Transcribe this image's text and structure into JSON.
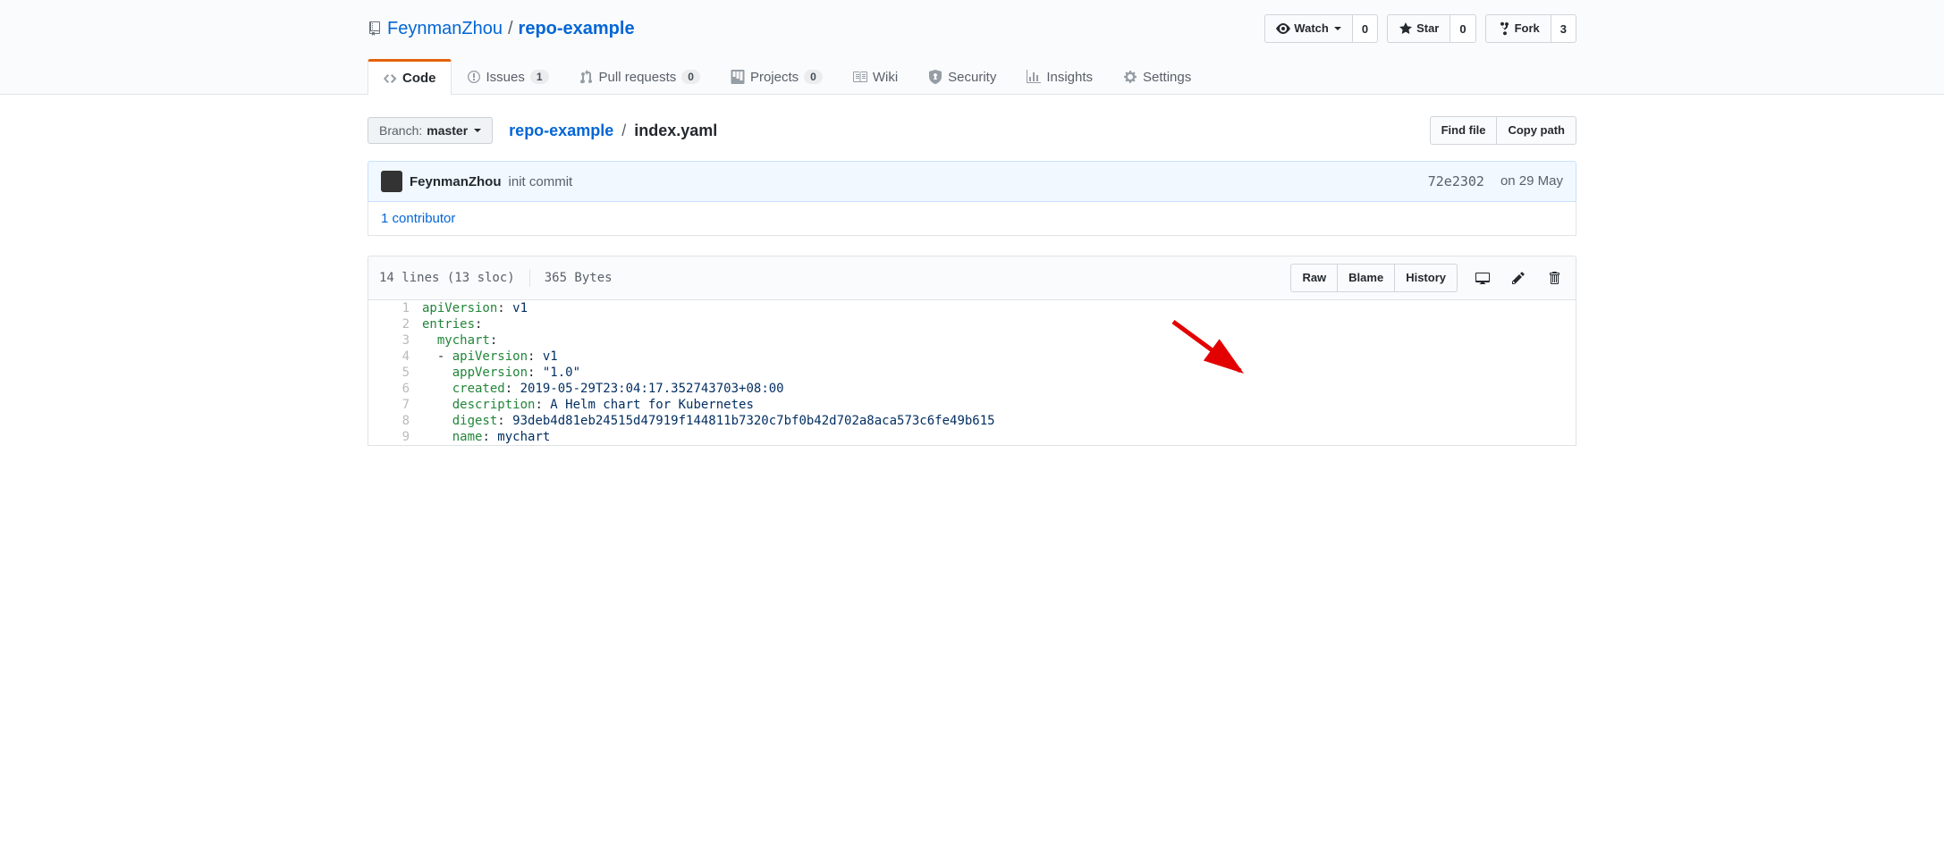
{
  "header": {
    "owner": "FeynmanZhou",
    "repo": "repo-example",
    "actions": {
      "watch_label": "Watch",
      "watch_count": "0",
      "star_label": "Star",
      "star_count": "0",
      "fork_label": "Fork",
      "fork_count": "3"
    }
  },
  "nav": {
    "code": "Code",
    "issues": "Issues",
    "issues_count": "1",
    "pulls": "Pull requests",
    "pulls_count": "0",
    "projects": "Projects",
    "projects_count": "0",
    "wiki": "Wiki",
    "security": "Security",
    "insights": "Insights",
    "settings": "Settings"
  },
  "file_nav": {
    "branch_label": "Branch:",
    "branch_value": "master",
    "breadcrumb_root": "repo-example",
    "breadcrumb_file": "index.yaml",
    "find_file": "Find file",
    "copy_path": "Copy path"
  },
  "commit_tease": {
    "author": "FeynmanZhou",
    "message": "init commit",
    "sha": "72e2302",
    "date": "on 29 May",
    "contributors": "1 contributor"
  },
  "blob": {
    "stats_lines": "14 lines (13 sloc)",
    "stats_bytes": "365 Bytes",
    "raw": "Raw",
    "blame": "Blame",
    "history": "History"
  },
  "code_lines": [
    {
      "n": "1",
      "tokens": [
        {
          "c": "pl-ent",
          "t": "apiVersion"
        },
        {
          "c": "",
          "t": ": "
        },
        {
          "c": "pl-s",
          "t": "v1"
        }
      ]
    },
    {
      "n": "2",
      "tokens": [
        {
          "c": "pl-ent",
          "t": "entries"
        },
        {
          "c": "",
          "t": ":"
        }
      ]
    },
    {
      "n": "3",
      "tokens": [
        {
          "c": "",
          "t": "  "
        },
        {
          "c": "pl-ent",
          "t": "mychart"
        },
        {
          "c": "",
          "t": ":"
        }
      ]
    },
    {
      "n": "4",
      "tokens": [
        {
          "c": "",
          "t": "  - "
        },
        {
          "c": "pl-ent",
          "t": "apiVersion"
        },
        {
          "c": "",
          "t": ": "
        },
        {
          "c": "pl-s",
          "t": "v1"
        }
      ]
    },
    {
      "n": "5",
      "tokens": [
        {
          "c": "",
          "t": "    "
        },
        {
          "c": "pl-ent",
          "t": "appVersion"
        },
        {
          "c": "",
          "t": ": "
        },
        {
          "c": "pl-s",
          "t": "\"1.0\""
        }
      ]
    },
    {
      "n": "6",
      "tokens": [
        {
          "c": "",
          "t": "    "
        },
        {
          "c": "pl-ent",
          "t": "created"
        },
        {
          "c": "",
          "t": ": "
        },
        {
          "c": "pl-s",
          "t": "2019-05-29T23:04:17.352743703+08:00"
        }
      ]
    },
    {
      "n": "7",
      "tokens": [
        {
          "c": "",
          "t": "    "
        },
        {
          "c": "pl-ent",
          "t": "description"
        },
        {
          "c": "",
          "t": ": "
        },
        {
          "c": "pl-s",
          "t": "A Helm chart for Kubernetes"
        }
      ]
    },
    {
      "n": "8",
      "tokens": [
        {
          "c": "",
          "t": "    "
        },
        {
          "c": "pl-ent",
          "t": "digest"
        },
        {
          "c": "",
          "t": ": "
        },
        {
          "c": "pl-s",
          "t": "93deb4d81eb24515d47919f144811b7320c7bf0b42d702a8aca573c6fe49b615"
        }
      ]
    },
    {
      "n": "9",
      "tokens": [
        {
          "c": "",
          "t": "    "
        },
        {
          "c": "pl-ent",
          "t": "name"
        },
        {
          "c": "",
          "t": ": "
        },
        {
          "c": "pl-s",
          "t": "mychart"
        }
      ]
    }
  ]
}
